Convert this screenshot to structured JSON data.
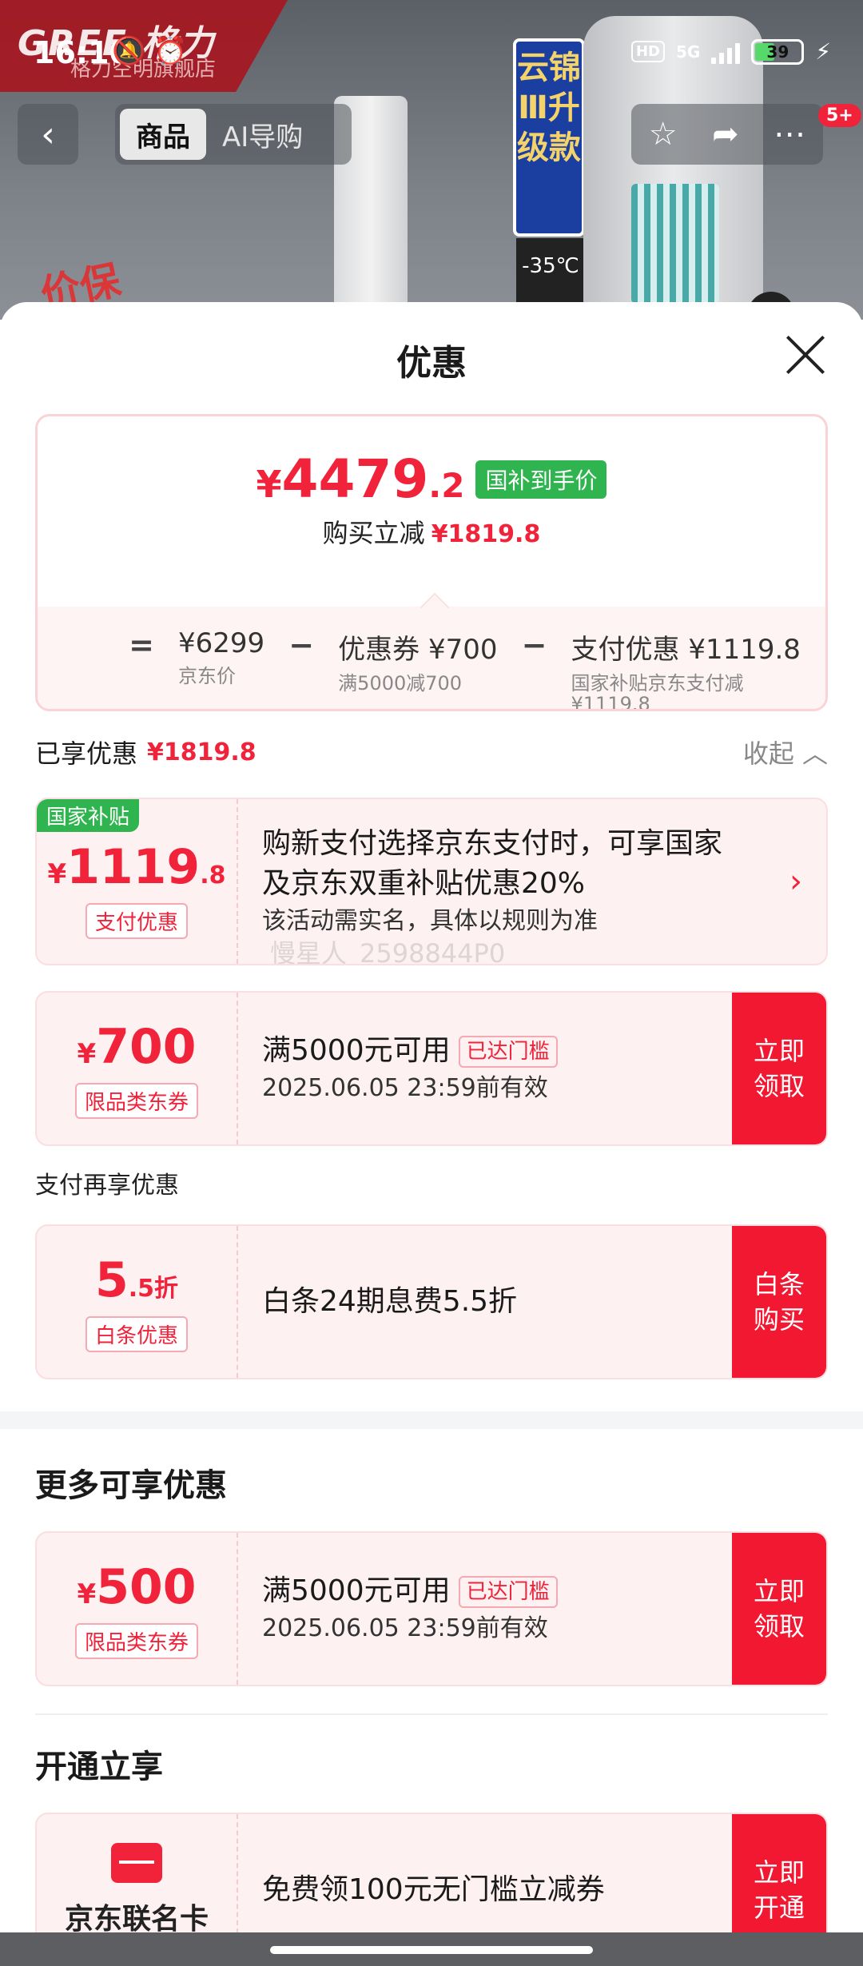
{
  "status_bar": {
    "time": "16:10",
    "hd": "HD",
    "network": "5G",
    "battery": "39"
  },
  "nav": {
    "back": "‹",
    "tabs": [
      {
        "label": "商品"
      },
      {
        "label": "AI导购"
      }
    ],
    "badge": "5+"
  },
  "bg": {
    "brand": "GREE 格力",
    "store": "格力空明旗舰店",
    "panel_text": "云锦Ⅲ升级款",
    "temp": "-35℃",
    "promo": "价保"
  },
  "sheet": {
    "title": "优惠",
    "summary": {
      "currency": "¥",
      "price_int": "4479",
      "price_dec": ".2",
      "tag": "国补到手价",
      "reduce_label": "购买立减",
      "reduce_value": "¥1819.8",
      "equation": {
        "eq": "=",
        "minus": "−",
        "jd_price": "¥6299",
        "jd_price_label": "京东价",
        "coupon": "优惠券 ¥700",
        "coupon_sub": "满5000减700",
        "pay": "支付优惠 ¥1119.8",
        "pay_sub1": "国家补贴京东支付减",
        "pay_sub2": "¥1119.8"
      }
    },
    "enjoyed": {
      "label": "已享优惠",
      "value": "¥1819.8",
      "collapse": "收起 ︿"
    },
    "card_subsidy": {
      "tag": "国家补贴",
      "currency": "¥",
      "amount": "1119",
      "dec": ".8",
      "type": "支付优惠",
      "line1": "购新支付选择京东支付时，可享国家",
      "line2": "及京东双重补贴优惠20%",
      "line3": "该活动需实名，具体以规则为准",
      "watermark": "慢星人_2598844P0"
    },
    "card_coupon700": {
      "currency": "¥",
      "amount": "700",
      "type": "限品类东券",
      "cond": "满5000元可用",
      "reached": "已达门槛",
      "valid": "2025.06.05 23:59前有效",
      "cta": "立即领取"
    },
    "pay_again_label": "支付再享优惠",
    "card_baitiao": {
      "amount": "5",
      "dec": ".5折",
      "type": "白条优惠",
      "desc": "白条24期息费5.5折",
      "cta": "白条购买"
    },
    "more_label": "更多可享优惠",
    "card_coupon500": {
      "currency": "¥",
      "amount": "500",
      "type": "限品类东券",
      "cond": "满5000元可用",
      "reached": "已达门槛",
      "valid": "2025.06.05 23:59前有效",
      "cta": "立即领取"
    },
    "open_label": "开通立享",
    "card_cobrand": {
      "name": "京东联名卡",
      "desc": "免费领100元无门槛立减券",
      "cta": "立即开通"
    }
  }
}
